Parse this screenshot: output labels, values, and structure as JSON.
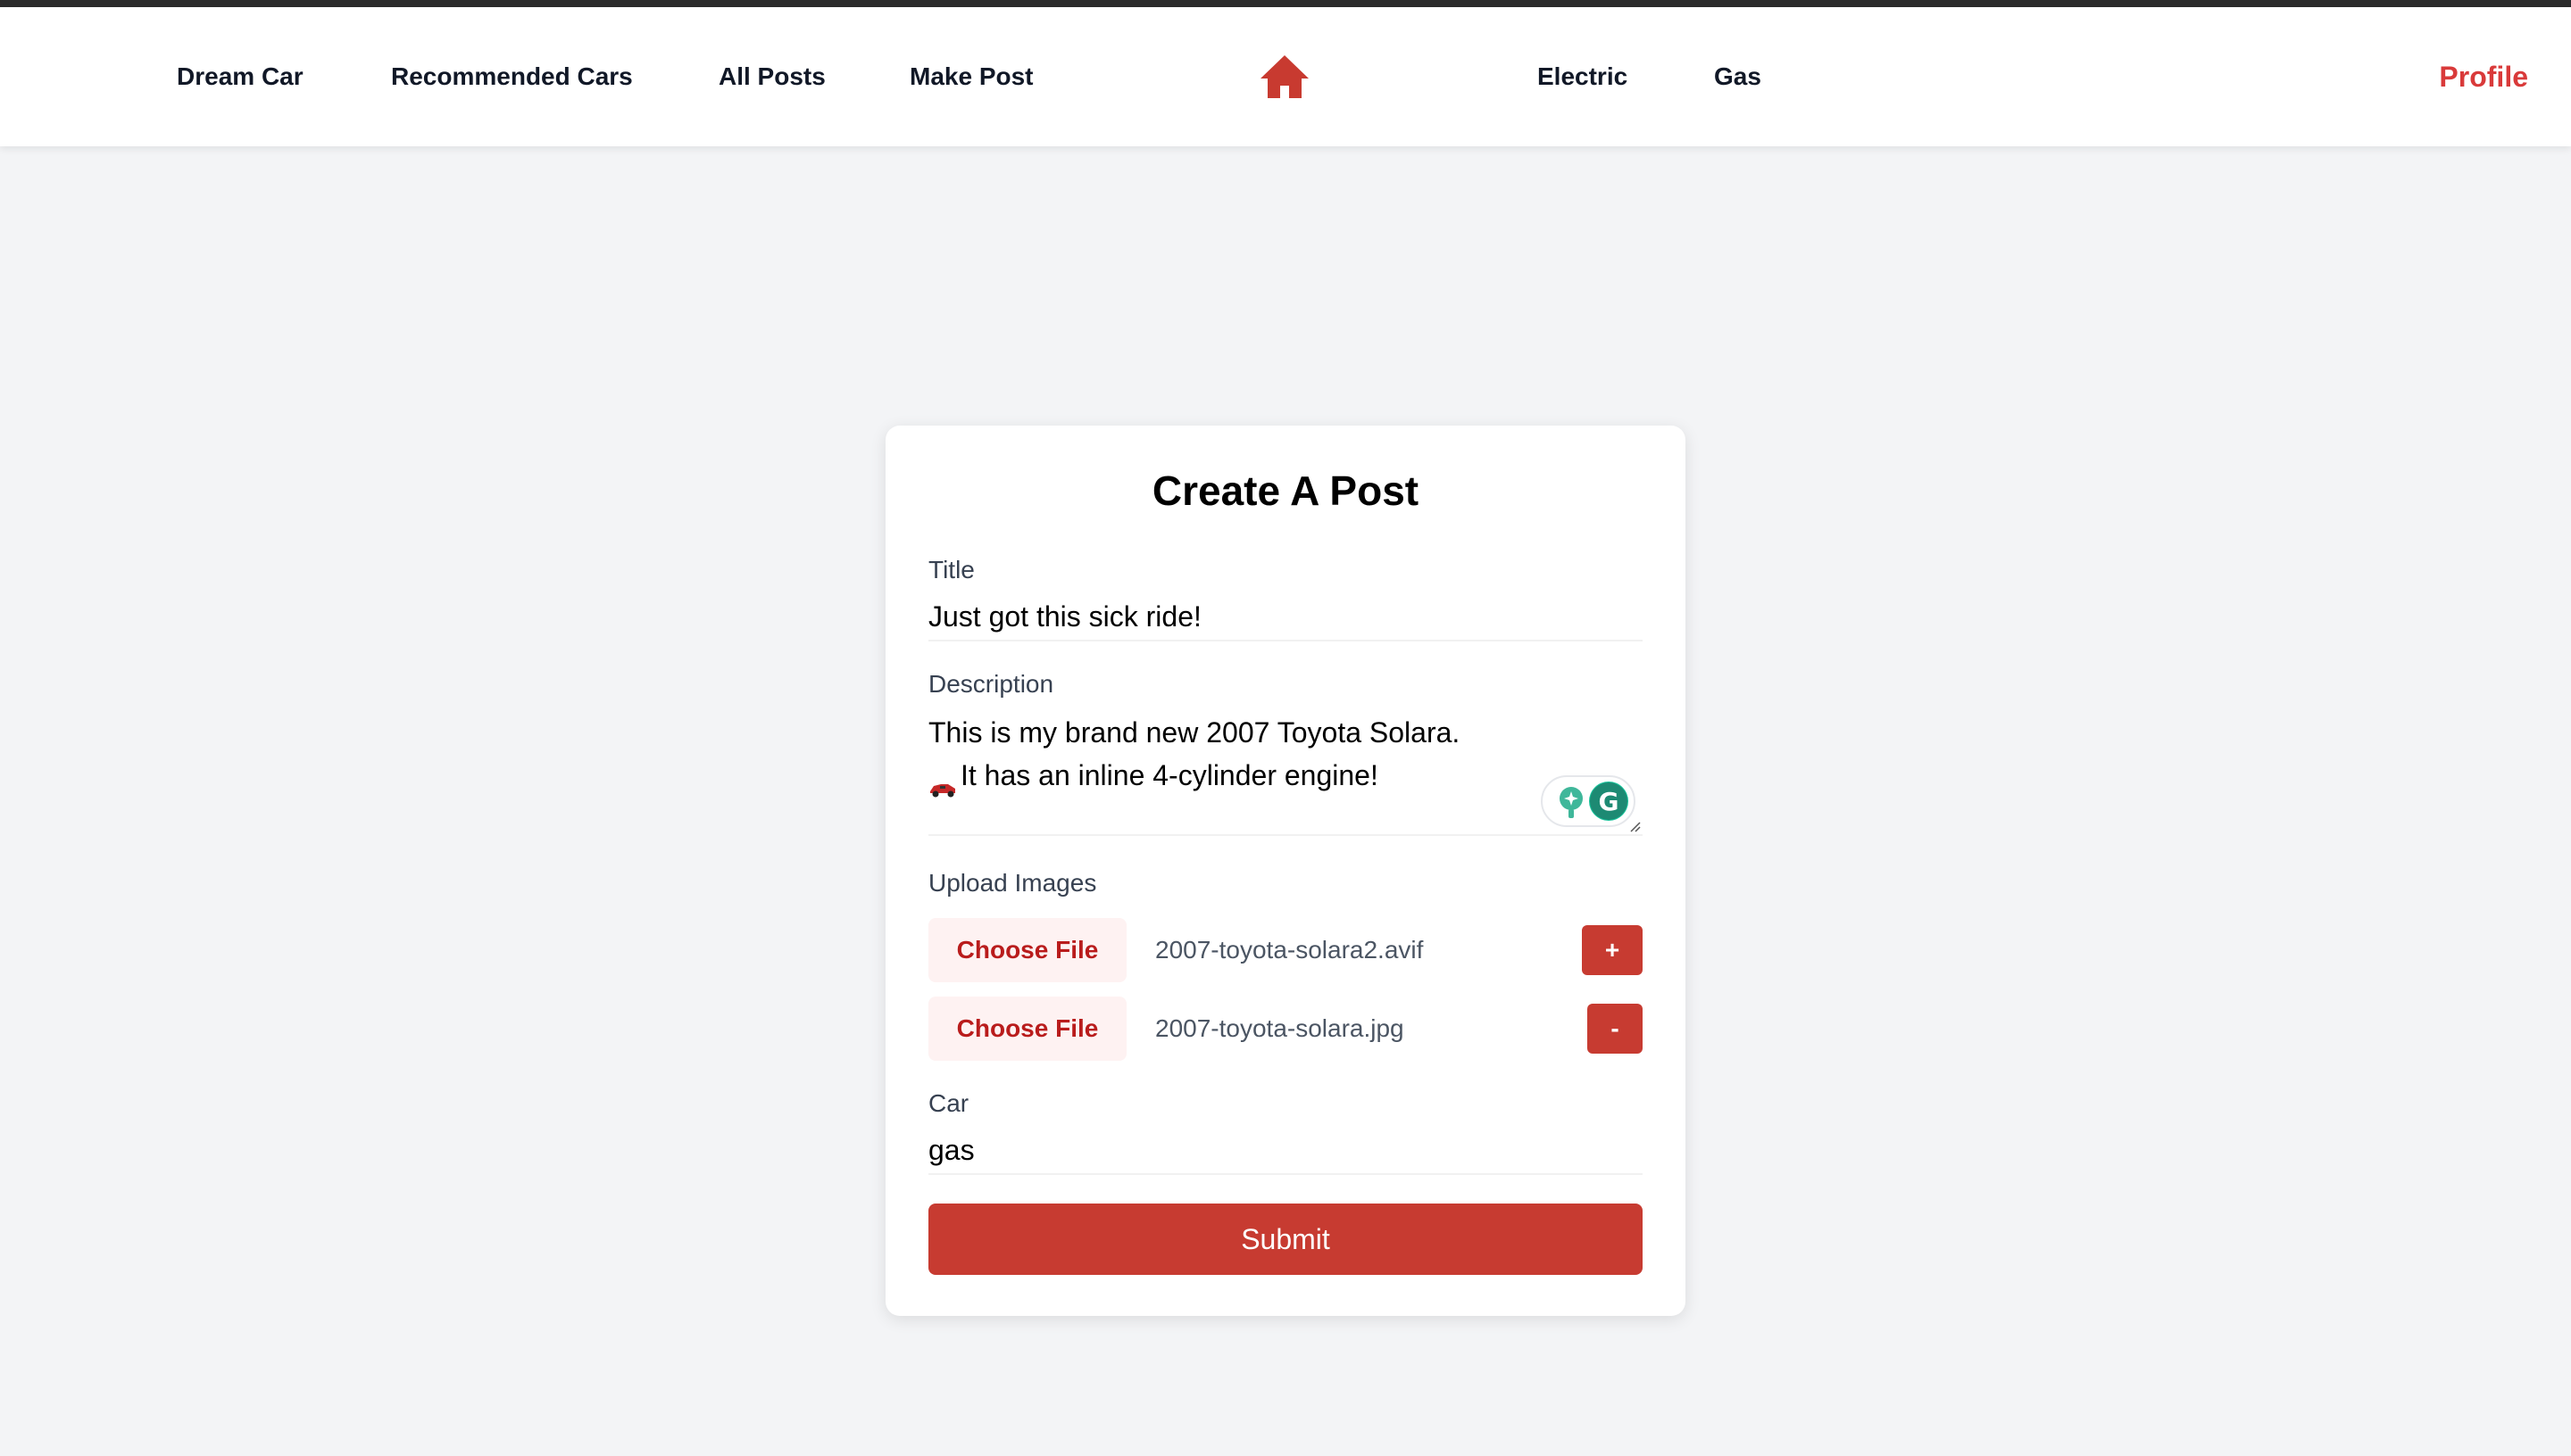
{
  "colors": {
    "brand": "#c73b31",
    "profile": "#d93a3a",
    "home_icon": "#c83a30",
    "page_bg": "#f3f4f6"
  },
  "nav": {
    "links": [
      "Dream Car",
      "Recommended Cars",
      "All Posts",
      "Make Post",
      "Electric",
      "Gas"
    ],
    "home_icon": "home-icon",
    "profile_label": "Profile"
  },
  "form": {
    "title": "Create A Post",
    "title_label": "Title",
    "title_value": "Just got this sick ride!",
    "description_label": "Description",
    "description_line1": "This is my brand new 2007 Toyota Solara.",
    "description_line2": "It has an inline 4-cylinder engine!",
    "description_emoji": "race-car-emoji",
    "upload_label": "Upload Images",
    "files": [
      {
        "button": "Choose File",
        "name": "2007-toyota-solara2.avif",
        "action": "+"
      },
      {
        "button": "Choose File",
        "name": "2007-toyota-solara.jpg",
        "action": "-"
      }
    ],
    "car_label": "Car",
    "car_value": "gas",
    "submit_label": "Submit"
  }
}
